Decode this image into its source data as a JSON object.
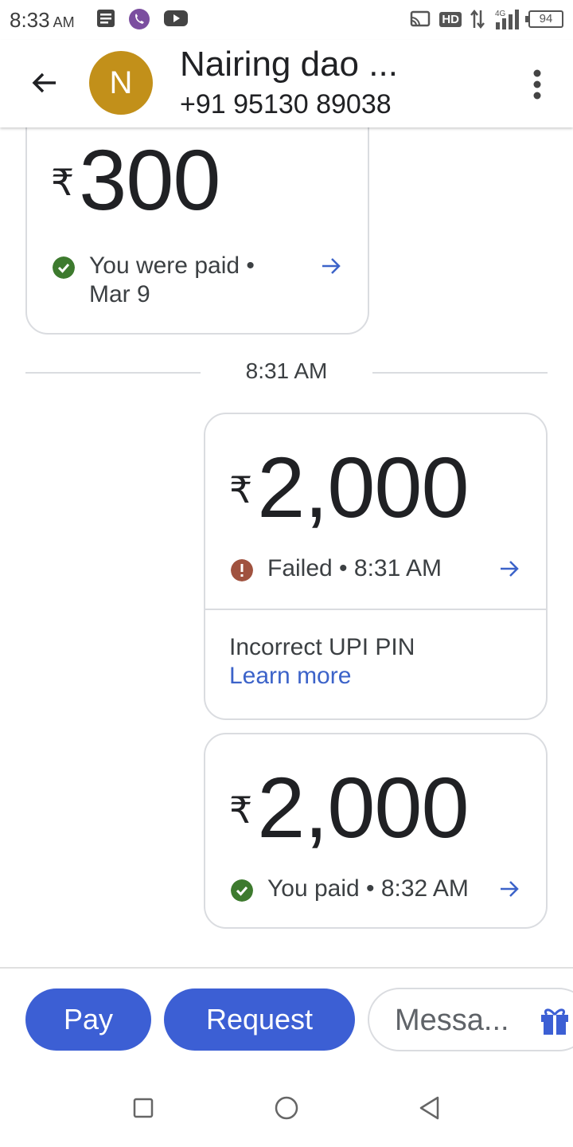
{
  "status_bar": {
    "time": "8:33",
    "ampm": "AM",
    "network": "4G",
    "battery": "94"
  },
  "header": {
    "avatar_letter": "N",
    "contact_name": "Nairing dao ...",
    "phone": "+91 95130 89038"
  },
  "messages": [
    {
      "currency": "₹",
      "amount": "300",
      "status": "You were paid • Mar 9"
    },
    {
      "currency": "₹",
      "amount": "2,000",
      "status": "Failed • 8:31 AM",
      "reason": "Incorrect UPI PIN",
      "link": "Learn more"
    },
    {
      "currency": "₹",
      "amount": "2,000",
      "status": "You paid • 8:32 AM"
    }
  ],
  "time_separator": "8:31 AM",
  "actions": {
    "pay": "Pay",
    "request": "Request",
    "message_placeholder": "Messa..."
  },
  "colors": {
    "accent": "#3c5fd4",
    "link": "#3c63c9",
    "success": "#3d7a2e",
    "error": "#a0523f",
    "avatar": "#c2901a"
  }
}
